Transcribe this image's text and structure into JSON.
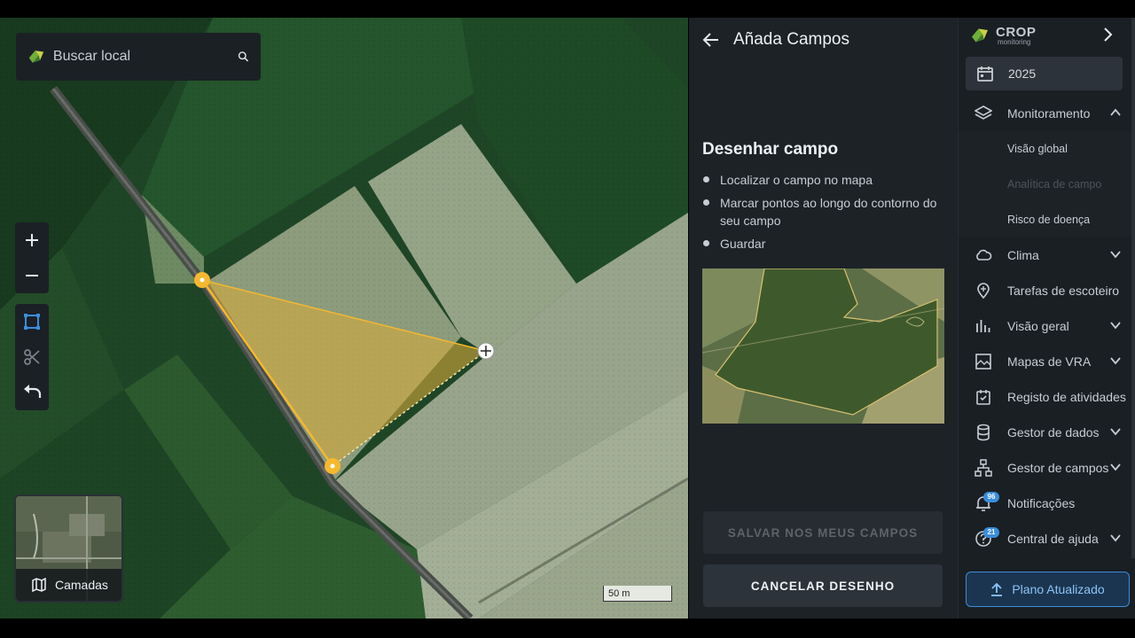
{
  "map": {
    "search_placeholder": "Buscar local",
    "layers_label": "Camadas",
    "scale_label": "50 m",
    "zoom_in_icon": "plus-icon",
    "zoom_out_icon": "minus-icon",
    "draw_polygon_icon": "polygon-icon",
    "cut_icon": "scissors-icon",
    "undo_icon": "undo-icon",
    "polygon_color": "#f5b82e"
  },
  "panel": {
    "title": "Añada Campos",
    "section_title": "Desenhar campo",
    "steps": [
      "Localizar o campo no mapa",
      "Marcar pontos ao longo do contorno do seu campo",
      "Guardar"
    ],
    "save_button": "SALVAR NOS MEUS CAMPOS",
    "cancel_button": "CANCELAR DESENHO"
  },
  "sidebar": {
    "brand_name": "CROP",
    "brand_sub": "monitoring",
    "year": "2025",
    "items": [
      {
        "label": "Monitoramento",
        "icon": "layers-icon",
        "expanded": true
      },
      {
        "label": "Visão global"
      },
      {
        "label": "Analítica de campo",
        "disabled": true
      },
      {
        "label": "Risco de doença"
      },
      {
        "label": "Clima",
        "icon": "cloud-icon"
      },
      {
        "label": "Tarefas de escoteiro",
        "icon": "pin-icon"
      },
      {
        "label": "Visão geral",
        "icon": "bar-chart-icon"
      },
      {
        "label": "Mapas de VRA",
        "icon": "image-map-icon"
      },
      {
        "label": "Registo de atividades",
        "icon": "calendar-check-icon"
      },
      {
        "label": "Gestor de dados",
        "icon": "database-icon"
      },
      {
        "label": "Gestor de campos",
        "icon": "hierarchy-icon"
      },
      {
        "label": "Notificações",
        "icon": "bell-icon",
        "badge": "96"
      },
      {
        "label": "Central de ajuda",
        "icon": "help-icon",
        "badge": "21"
      }
    ],
    "plan_button": "Plano Atualizado",
    "accent_color": "#3a8edb"
  }
}
